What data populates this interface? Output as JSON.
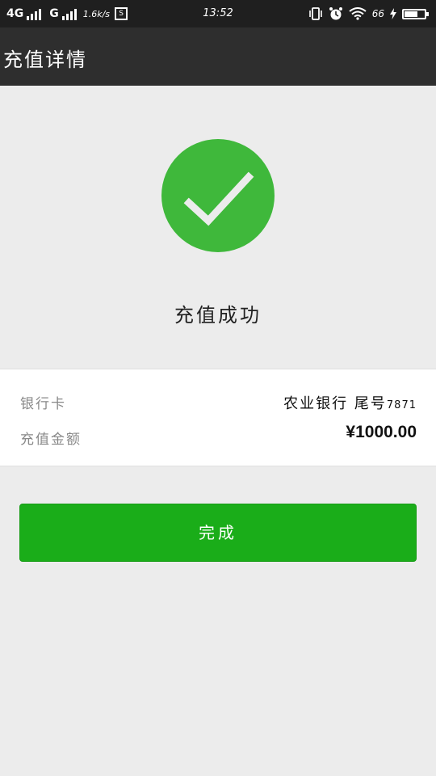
{
  "status_bar": {
    "network1": "4G",
    "network2": "G",
    "speed": "1.6k/s",
    "screenshot_glyph": "S",
    "time": "13:52",
    "battery_pct": "66",
    "battery_level": 0.66
  },
  "header": {
    "title": "充值详情"
  },
  "result": {
    "icon": "check-circle-icon",
    "icon_color": "#3fb83b",
    "message": "充值成功"
  },
  "details": {
    "card_label": "银行卡",
    "card_bank": "农业银行 尾号",
    "card_tail": "7871",
    "amount_label": "充值金额",
    "amount_value": "¥1000.00"
  },
  "actions": {
    "done_label": "完成",
    "done_color": "#1aad19"
  }
}
